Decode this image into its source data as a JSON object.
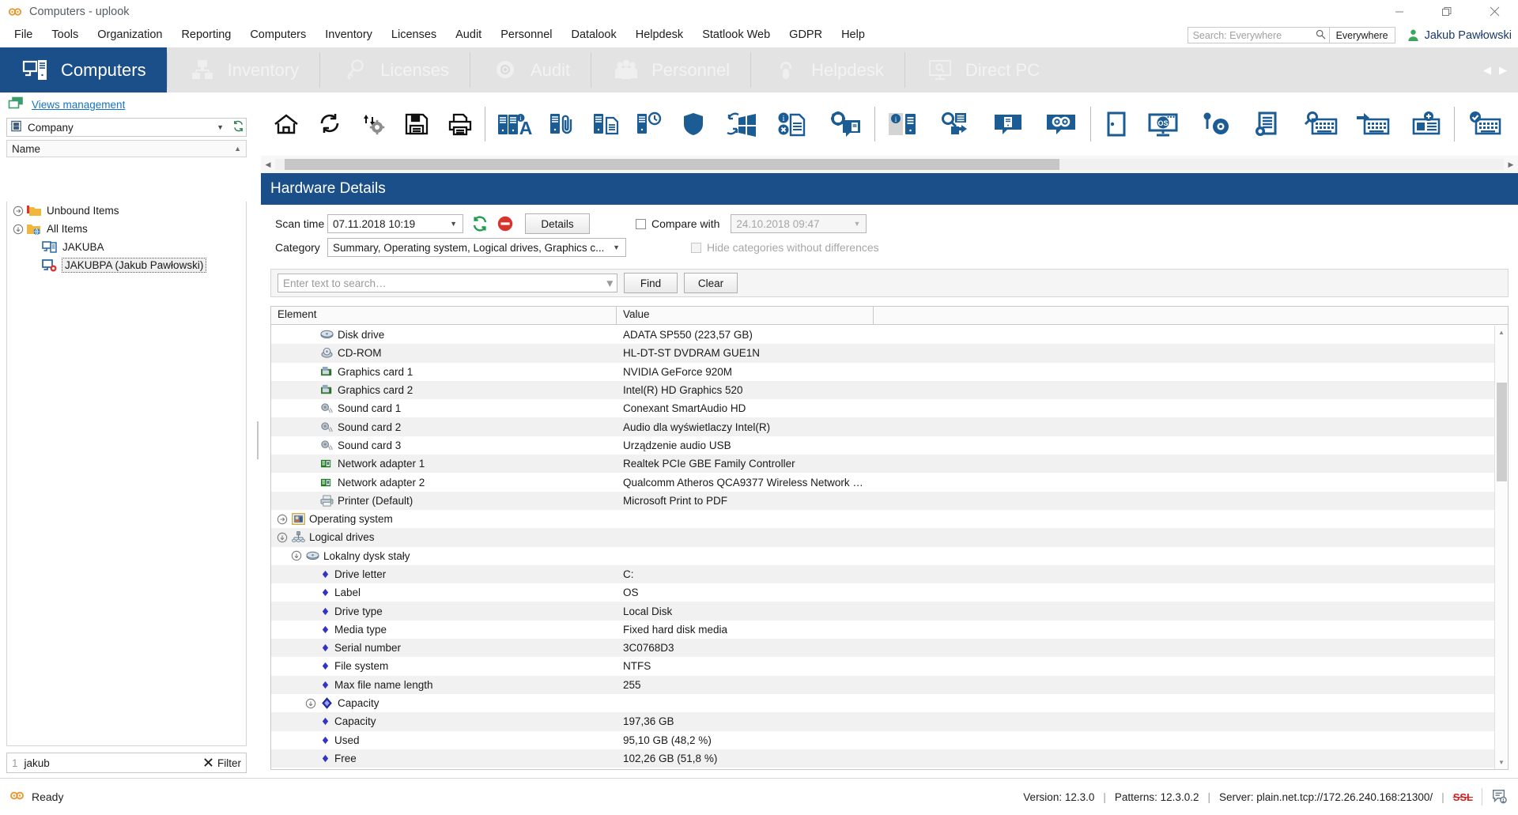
{
  "window": {
    "title": "Computers - uplook",
    "app_icon": "uplook-logo-icon",
    "buttons": {
      "minimize": "minimize-icon",
      "maximize": "maximize-icon",
      "close": "close-icon"
    }
  },
  "menubar": {
    "items": [
      "File",
      "Tools",
      "Organization",
      "Reporting",
      "Computers",
      "Inventory",
      "Licenses",
      "Audit",
      "Personnel",
      "Datalook",
      "Helpdesk",
      "Statlook Web",
      "GDPR",
      "Help"
    ],
    "search": {
      "placeholder": "Search: Everywhere",
      "value": "",
      "scope_button": "Everywhere"
    },
    "user": "Jakub Pawłowski"
  },
  "ribbon": {
    "tabs": [
      {
        "label": "Computers",
        "icon": "computer-icon",
        "active": true
      },
      {
        "label": "Inventory",
        "icon": "network-devices-icon",
        "active": false
      },
      {
        "label": "Licenses",
        "icon": "key-icon",
        "active": false
      },
      {
        "label": "Audit",
        "icon": "disc-icon",
        "active": false
      },
      {
        "label": "Personnel",
        "icon": "people-icon",
        "active": false
      },
      {
        "label": "Helpdesk",
        "icon": "headset-icon",
        "active": false
      },
      {
        "label": "Direct PC",
        "icon": "monitor-search-icon",
        "active": false
      }
    ],
    "nav_prev": "chevron-left-icon",
    "nav_next": "chevron-right-icon"
  },
  "toolbar": {
    "groups": [
      [
        "home-icon",
        "refresh-icon",
        "sync-settings-icon",
        "save-icon",
        "print-icon"
      ],
      [
        "computers-info-icon",
        "computer-attachment-icon",
        "computer-document-icon",
        "computer-history-icon",
        "shield-icon",
        "windows-update-icon",
        "document-error-icon",
        "computer-settings-chat-icon"
      ],
      [
        "computer-info-grey-icon",
        "computer-search-export-icon",
        "computer-comment-icon",
        "uplook-comment-icon"
      ],
      [
        "door-icon",
        "os-monitor-icon",
        "key-disc-icon",
        "certificate-icon",
        "keyboard-search-icon",
        "keyboard-export-icon",
        "keyboard-add-icon"
      ],
      [
        "keyboard-check-icon",
        "keyboard-help-icon"
      ]
    ],
    "scrollbar": {
      "left_arrow": "chevron-left-icon",
      "right_arrow": "chevron-right-icon"
    }
  },
  "sidebar": {
    "views_management": "Views management",
    "views_icon": "views-icon",
    "company_selector": {
      "value": "Company",
      "icon": "company-icon",
      "caret": "chevron-down-icon",
      "refresh": "refresh-small-icon"
    },
    "tree_header": {
      "label": "Name",
      "sort": "sort-asc-icon"
    },
    "tree": [
      {
        "label": "Unbound Items",
        "level": 1,
        "expander": "collapsed",
        "icon": "folder-unbound-icon",
        "selected": false
      },
      {
        "label": "All Items",
        "level": 1,
        "expander": "expanded",
        "icon": "folder-global-icon",
        "selected": false
      },
      {
        "label": "JAKUBA",
        "level": 2,
        "expander": "none",
        "icon": "computer-small-icon",
        "selected": false
      },
      {
        "label": "JAKUBPA (Jakub Pawłowski)",
        "level": 2,
        "expander": "none",
        "icon": "computer-small-red-icon",
        "selected": true
      }
    ],
    "filter": {
      "count": "1",
      "value": "jakub",
      "clear_icon": "x-icon",
      "label": "Filter"
    }
  },
  "main": {
    "panel_title": "Hardware Details",
    "scan_time": {
      "label": "Scan time",
      "value": "07.11.2018 10:19",
      "caret": "chevron-down-icon"
    },
    "refresh_button": "refresh-green-icon",
    "delete_button": "delete-red-icon",
    "details_button": "Details",
    "compare_with": {
      "label": "Compare with",
      "checked": false,
      "value": "24.10.2018 09:47",
      "caret": "chevron-down-icon"
    },
    "hide_categories": {
      "label": "Hide categories without differences",
      "checked": false,
      "disabled": true
    },
    "category": {
      "label": "Category",
      "value": "Summary, Operating system, Logical drives, Graphics c...",
      "caret": "chevron-down-icon"
    },
    "search": {
      "placeholder": "Enter text to search…",
      "value": "",
      "caret": "chevron-down-icon"
    },
    "find_button": "Find",
    "clear_button": "Clear",
    "grid": {
      "columns": [
        "Element",
        "Value"
      ],
      "rows": [
        {
          "element": "Disk drive",
          "value": "ADATA SP550 (223,57 GB)",
          "indent": 2,
          "expander": "none",
          "icon": "disk-icon",
          "kind": "item",
          "alt": false
        },
        {
          "element": "CD-ROM",
          "value": "HL-DT-ST DVDRAM GUE1N",
          "indent": 2,
          "expander": "none",
          "icon": "cdrom-icon",
          "kind": "item",
          "alt": true
        },
        {
          "element": "Graphics card 1",
          "value": "NVIDIA GeForce 920M",
          "indent": 2,
          "expander": "none",
          "icon": "gpu-icon",
          "kind": "item",
          "alt": false
        },
        {
          "element": "Graphics card 2",
          "value": "Intel(R) HD Graphics 520",
          "indent": 2,
          "expander": "none",
          "icon": "gpu-icon",
          "kind": "item",
          "alt": true
        },
        {
          "element": "Sound card 1",
          "value": "Conexant SmartAudio HD",
          "indent": 2,
          "expander": "none",
          "icon": "sound-icon",
          "kind": "item",
          "alt": false
        },
        {
          "element": "Sound card 2",
          "value": "Audio dla wyświetlaczy Intel(R)",
          "indent": 2,
          "expander": "none",
          "icon": "sound-icon",
          "kind": "item",
          "alt": true
        },
        {
          "element": "Sound card 3",
          "value": "Urządzenie audio USB",
          "indent": 2,
          "expander": "none",
          "icon": "sound-icon",
          "kind": "item",
          "alt": false
        },
        {
          "element": "Network adapter 1",
          "value": "Realtek PCIe GBE Family Controller",
          "indent": 2,
          "expander": "none",
          "icon": "network-icon",
          "kind": "item",
          "alt": true
        },
        {
          "element": "Network adapter 2",
          "value": "Qualcomm Atheros QCA9377 Wireless Network …",
          "indent": 2,
          "expander": "none",
          "icon": "network-icon",
          "kind": "item",
          "alt": false
        },
        {
          "element": "Printer (Default)",
          "value": "Microsoft Print to PDF",
          "indent": 2,
          "expander": "none",
          "icon": "printer-icon",
          "kind": "item",
          "alt": true
        },
        {
          "element": "Operating system",
          "value": "",
          "indent": 0,
          "expander": "collapsed",
          "icon": "os-icon",
          "kind": "group",
          "alt": false
        },
        {
          "element": "Logical drives",
          "value": "",
          "indent": 0,
          "expander": "expanded",
          "icon": "drives-icon",
          "kind": "group",
          "alt": true
        },
        {
          "element": "Lokalny dysk stały",
          "value": "",
          "indent": 1,
          "expander": "expanded",
          "icon": "disk-icon",
          "kind": "group",
          "alt": false
        },
        {
          "element": "Drive letter",
          "value": "C:",
          "indent": 3,
          "expander": "none",
          "icon": "bullet-icon",
          "kind": "leaf",
          "alt": true
        },
        {
          "element": "Label",
          "value": "OS",
          "indent": 3,
          "expander": "none",
          "icon": "bullet-icon",
          "kind": "leaf",
          "alt": false
        },
        {
          "element": "Drive type",
          "value": "Local Disk",
          "indent": 3,
          "expander": "none",
          "icon": "bullet-icon",
          "kind": "leaf",
          "alt": true
        },
        {
          "element": "Media type",
          "value": "Fixed hard disk media",
          "indent": 3,
          "expander": "none",
          "icon": "bullet-icon",
          "kind": "leaf",
          "alt": false
        },
        {
          "element": "Serial number",
          "value": "3C0768D3",
          "indent": 3,
          "expander": "none",
          "icon": "bullet-icon",
          "kind": "leaf",
          "alt": true
        },
        {
          "element": "File system",
          "value": "NTFS",
          "indent": 3,
          "expander": "none",
          "icon": "bullet-icon",
          "kind": "leaf",
          "alt": false
        },
        {
          "element": "Max file name length",
          "value": "255",
          "indent": 3,
          "expander": "none",
          "icon": "bullet-icon",
          "kind": "leaf",
          "alt": true
        },
        {
          "element": "Capacity",
          "value": "",
          "indent": 2,
          "expander": "expanded",
          "icon": "capacity-icon",
          "kind": "group",
          "alt": false
        },
        {
          "element": "Capacity",
          "value": "197,36 GB",
          "indent": 3,
          "expander": "none",
          "icon": "bullet-icon",
          "kind": "leaf",
          "alt": true
        },
        {
          "element": "Used",
          "value": "95,10 GB (48,2 %)",
          "indent": 3,
          "expander": "none",
          "icon": "bullet-icon",
          "kind": "leaf",
          "alt": false
        },
        {
          "element": "Free",
          "value": "102,26 GB (51,8 %)",
          "indent": 3,
          "expander": "none",
          "icon": "bullet-icon",
          "kind": "leaf",
          "alt": true
        }
      ],
      "usage_bar": {
        "used_percent": 48.2,
        "free_percent": 51.8,
        "used_color": "#ef1c41",
        "free_color": "#17b517"
      },
      "scrollbar": {
        "up": "chevron-up-icon",
        "down": "chevron-down-icon"
      }
    }
  },
  "statusbar": {
    "icon": "uplook-logo-icon",
    "status": "Ready",
    "version": "Version: 12.3.0",
    "patterns": "Patterns: 12.3.0.2",
    "server": "Server: plain.net.tcp://172.26.240.168:21300/",
    "ssl": "SSL",
    "sep": "|",
    "notification_icon": "notification-icon"
  },
  "colors": {
    "accent_blue": "#1b4f8a",
    "ribbon_grey": "#e3e3e3",
    "icon_blue": "#1b5c94",
    "link_blue": "#1574c4",
    "used_red": "#ef1c41",
    "free_green": "#17b517",
    "ssl_red": "#d21b1b",
    "logo_orange": "#e8972b"
  }
}
